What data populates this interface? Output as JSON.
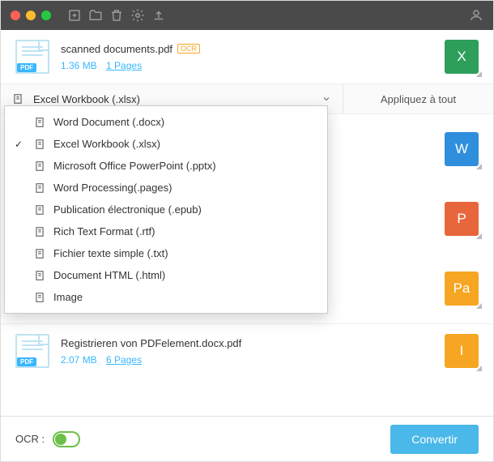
{
  "files": [
    {
      "name": "scanned documents.pdf",
      "ocr": true,
      "size": "1.36 MB",
      "pages": "1 Pages",
      "target": "X",
      "targetColor": "#2e9e5b"
    },
    {
      "name": "",
      "size": "",
      "pages": "",
      "target": "W",
      "targetColor": "#2f8fdd"
    },
    {
      "name": "",
      "size": "",
      "pages": "",
      "target": "P",
      "targetColor": "#e8663c"
    },
    {
      "name": "",
      "size": "",
      "pages": "",
      "target": "Pa",
      "targetColor": "#f6a623"
    },
    {
      "name": "Registrieren von PDFelement.docx.pdf",
      "size": "2.07 MB",
      "pages": "6 Pages",
      "target": "I",
      "targetColor": "#f6a623"
    }
  ],
  "formatSelector": {
    "selected": "Excel Workbook (.xlsx)",
    "applyAll": "Appliquez à tout",
    "options": [
      "Word Document (.docx)",
      "Excel Workbook (.xlsx)",
      "Microsoft Office PowerPoint (.pptx)",
      "Word Processing(.pages)",
      "Publication électronique (.epub)",
      "Rich Text Format (.rtf)",
      "Fichier texte simple (.txt)",
      "Document HTML (.html)",
      "Image"
    ],
    "selectedIndex": 1
  },
  "footer": {
    "ocrLabel": "OCR :",
    "convert": "Convertir"
  },
  "pdfBadge": "PDF",
  "ocrBadge": "OCR"
}
